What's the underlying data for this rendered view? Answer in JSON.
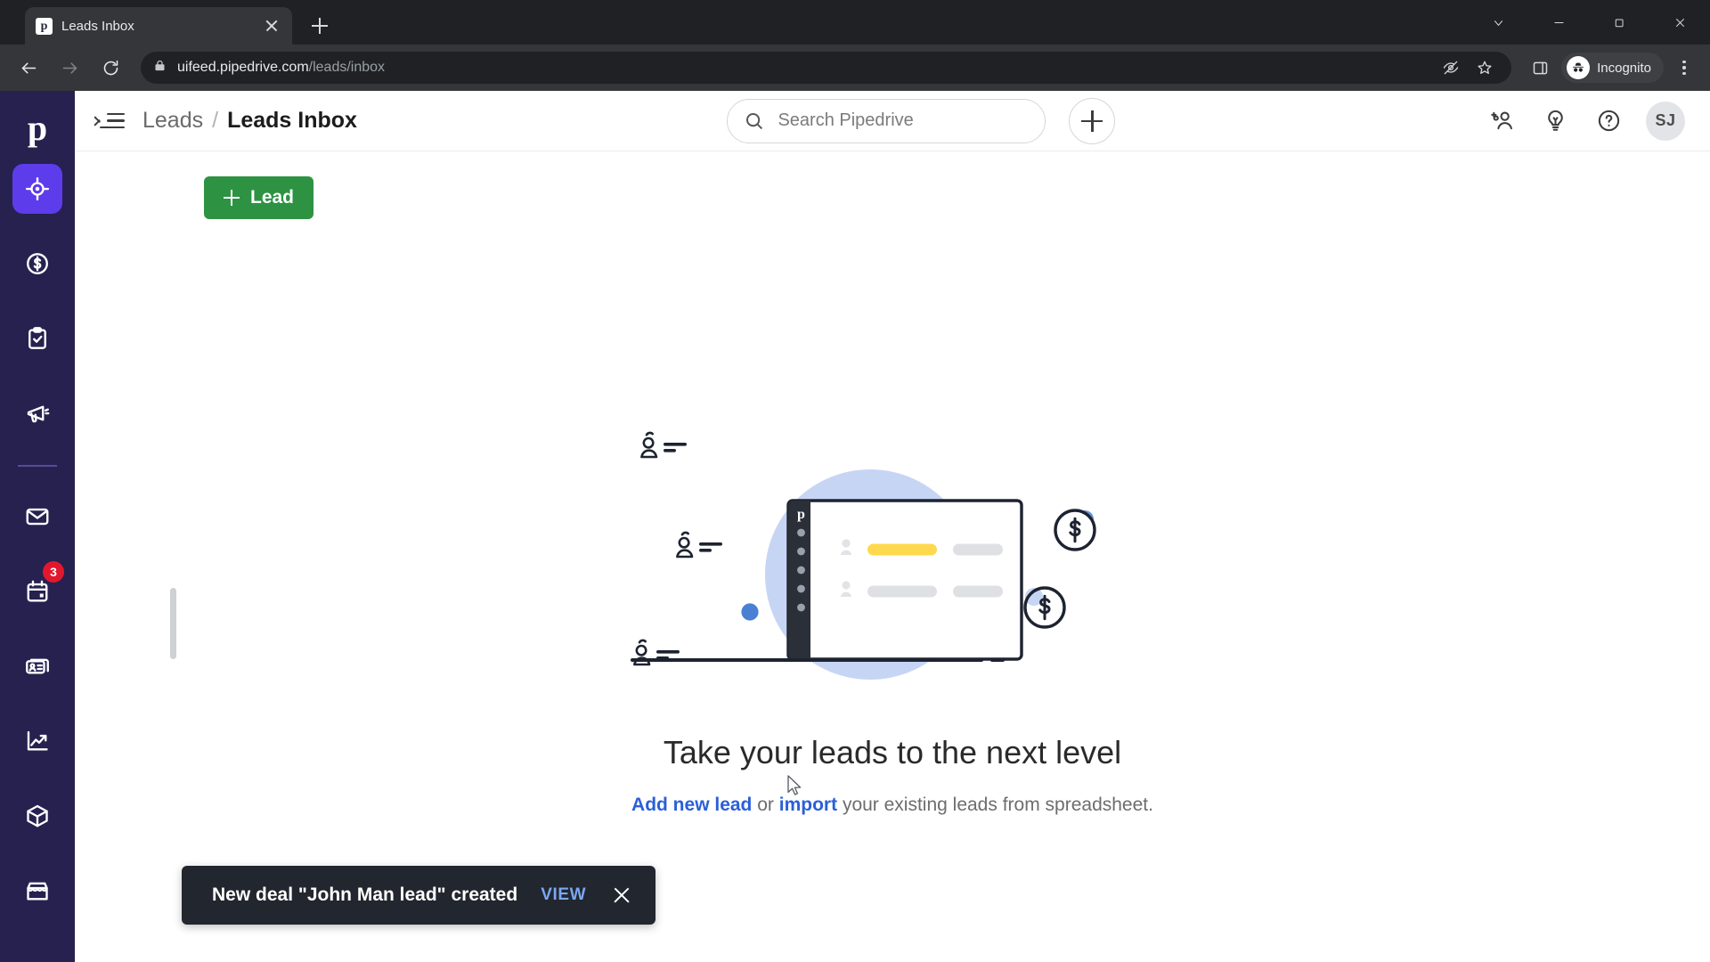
{
  "browser": {
    "tab": {
      "title": "Leads Inbox",
      "favicon_letter": "p",
      "close_label": "Close tab"
    },
    "new_tab_label": "New Tab",
    "window_controls": {
      "minimize": "Minimize",
      "maximize": "Maximize",
      "close": "Close",
      "tab_search": "Search tabs"
    },
    "nav": {
      "back": "Back",
      "forward": "Forward",
      "reload": "Reload"
    },
    "omnibox": {
      "host": "uifeed.pipedrive.com",
      "path": "/leads/inbox",
      "lock": "secure-lock-icon",
      "tracking_protection": "eye-off-icon",
      "bookmark": "star-icon"
    },
    "toolbar_right": {
      "side_panel": "side-panel-icon",
      "profile_label": "Incognito",
      "menu": "three-dot-menu"
    }
  },
  "sidebar": {
    "logo": "p",
    "items": [
      {
        "name": "leads",
        "icon": "target-icon",
        "active": true,
        "label": "Leads"
      },
      {
        "name": "deals",
        "icon": "dollar-circle-icon",
        "active": false,
        "label": "Deals"
      },
      {
        "name": "activities",
        "icon": "clipboard-check-icon",
        "active": false,
        "label": "Activities"
      },
      {
        "name": "campaigns",
        "icon": "megaphone-icon",
        "active": false,
        "label": "Campaigns"
      },
      {
        "name": "mail",
        "icon": "envelope-icon",
        "active": false,
        "label": "Mail"
      },
      {
        "name": "calendar",
        "icon": "calendar-icon",
        "active": false,
        "label": "Calendar",
        "badge": "3"
      },
      {
        "name": "contacts",
        "icon": "contact-card-icon",
        "active": false,
        "label": "Contacts"
      },
      {
        "name": "insights",
        "icon": "trend-chart-icon",
        "active": false,
        "label": "Insights"
      },
      {
        "name": "products",
        "icon": "box-icon",
        "active": false,
        "label": "Products"
      },
      {
        "name": "marketplace",
        "icon": "storefront-icon",
        "active": false,
        "label": "Marketplace"
      }
    ]
  },
  "header": {
    "menu_toggle": "collapse-menu-icon",
    "breadcrumb": {
      "parent": "Leads",
      "separator": "/",
      "current": "Leads Inbox"
    },
    "search": {
      "placeholder": "Search Pipedrive",
      "value": "",
      "icon": "search-icon"
    },
    "add_button": "+",
    "icons": {
      "invite": "add-user-icon",
      "tips": "lightbulb-icon",
      "help": "question-circle-icon"
    },
    "avatar_initials": "SJ"
  },
  "main": {
    "add_lead_button": "Lead",
    "empty_state": {
      "headline": "Take your leads to the next level",
      "link_add": "Add new lead",
      "text_or": "or",
      "link_import": "import",
      "text_rest": "your existing leads from spreadsheet.",
      "illustration": "leads-laptop-illustration"
    }
  },
  "toast": {
    "message": "New deal \"John Man lead\" created",
    "action": "VIEW",
    "close": "dismiss-toast"
  },
  "colors": {
    "brand_purple": "#26214f",
    "active_purple": "#5d3ceb",
    "green_button": "#2e9243",
    "link_blue": "#2a5fd9",
    "badge_red": "#e1182d",
    "toast_bg": "#22262e",
    "toast_action": "#7ba7f2",
    "illustration_blue": "#c7d5f5",
    "illustration_yellow": "#ffd94d",
    "accent_dot_blue": "#4a7fd4"
  }
}
